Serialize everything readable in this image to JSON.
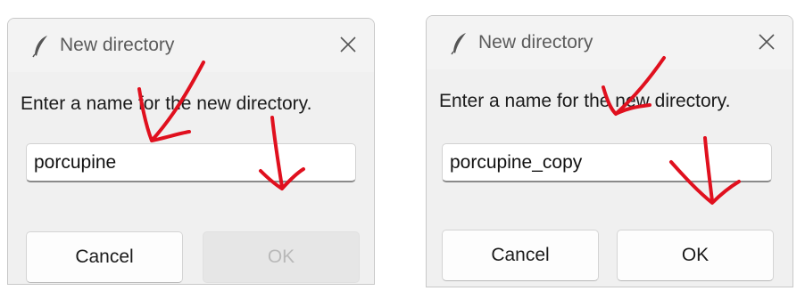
{
  "dialogs": [
    {
      "title": "New directory",
      "prompt": "Enter a name for the new directory.",
      "input_value": "porcupine",
      "cancel_label": "Cancel",
      "ok_label": "OK",
      "ok_enabled": false
    },
    {
      "title": "New directory",
      "prompt": "Enter a name for the new directory.",
      "input_value": "porcupine_copy",
      "cancel_label": "Cancel",
      "ok_label": "OK",
      "ok_enabled": true
    }
  ],
  "colors": {
    "annotation_red": "#e0101e",
    "disabled_text": "#b9b9b9",
    "dialog_bg": "#f0f0f0"
  }
}
